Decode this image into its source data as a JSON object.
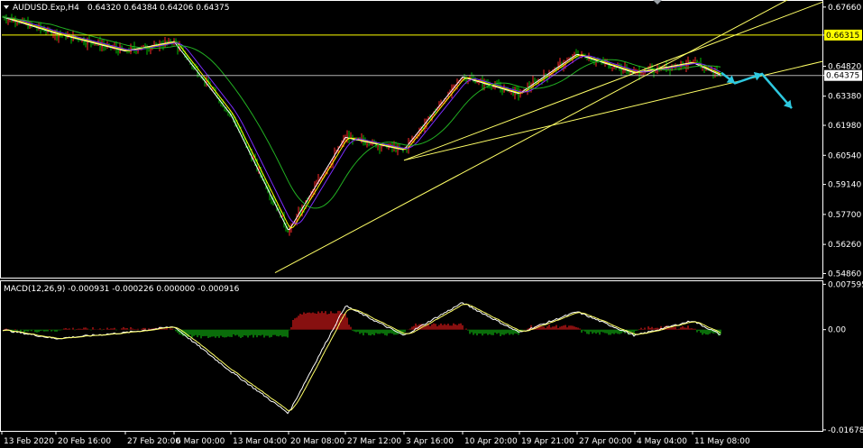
{
  "header": {
    "symbol": "AUDUSD.Exp,H4",
    "ohlc": "0.64320 0.64384 0.64206 0.64375"
  },
  "macd_header": "MACD(12,26,9) -0.000931 -0.000226 0.000000 -0.000916",
  "price_axis": {
    "ticks": [
      "0.67660",
      "0.66315",
      "0.64820",
      "0.64375",
      "0.63380",
      "0.61980",
      "0.60540",
      "0.59140",
      "0.57700",
      "0.56260",
      "0.54860"
    ],
    "hline_high_label": "0.66315",
    "current_price_label": "0.64375",
    "ylim": [
      0.5475,
      0.6787
    ]
  },
  "macd_axis": {
    "ticks": [
      "0.007595",
      "0.00",
      "-0.016785"
    ],
    "ylim": [
      -0.0168,
      0.0078
    ]
  },
  "time_axis": {
    "labels": [
      "13 Feb 2020",
      "20 Feb 16:00",
      "27 Feb 20:00",
      "6 Mar 00:00",
      "13 Mar 04:00",
      "20 Mar 08:00",
      "27 Mar 12:00",
      "3 Apr 16:00",
      "10 Apr 20:00",
      "19 Apr 21:00",
      "27 Apr 00:00",
      "4 May 04:00",
      "11 May 08:00"
    ]
  },
  "colors": {
    "background": "#000000",
    "bull_candle": "#ff2a2a",
    "bear_candle": "#00c000",
    "line_white": "#ffffff",
    "ma_fast": "#ffff00",
    "ma_mid": "#7b2cff",
    "ma_slow": "#22b022",
    "trendline": "#ffff66",
    "forecast_arrow": "#2ec9e0",
    "macd_signal": "#ffff66",
    "hist_pos": "#d01818",
    "hist_neg": "#0fa80f"
  },
  "chart_data": [
    {
      "type": "candlestick",
      "title": "AUDUSD.Exp,H4",
      "ylim": [
        0.5475,
        0.6787
      ],
      "key_points": [
        {
          "x": "13 Feb 2020",
          "y": 0.672
        },
        {
          "x": "20 Feb 16:00",
          "y": 0.664
        },
        {
          "x": "27 Feb 20:00",
          "y": 0.6555
        },
        {
          "x": "6 Mar 00:00",
          "y": 0.66
        },
        {
          "x": "13 Mar 04:00",
          "y": 0.625
        },
        {
          "x": "20 Mar 08:00",
          "y": 0.569
        },
        {
          "x": "27 Mar 12:00",
          "y": 0.614
        },
        {
          "x": "3 Apr 16:00",
          "y": 0.608
        },
        {
          "x": "10 Apr 20:00",
          "y": 0.643
        },
        {
          "x": "19 Apr 21:00",
          "y": 0.635
        },
        {
          "x": "27 Apr 00:00",
          "y": 0.654
        },
        {
          "x": "4 May 04:00",
          "y": 0.645
        },
        {
          "x": "11 May 08:00",
          "y": 0.65
        }
      ],
      "series": [
        {
          "name": "price"
        }
      ],
      "horizontal_lines": [
        0.66315,
        0.64375
      ]
    },
    {
      "type": "line+histogram",
      "title": "MACD(12,26,9)",
      "ylim": [
        -0.0168,
        0.0078
      ],
      "series": [
        {
          "name": "MACD histogram"
        },
        {
          "name": "MACD main"
        },
        {
          "name": "Signal"
        }
      ],
      "key_points": [
        {
          "x": "13 Feb 2020",
          "y": 0.0
        },
        {
          "x": "20 Feb 16:00",
          "y": -0.0015
        },
        {
          "x": "27 Feb 20:00",
          "y": -0.0005
        },
        {
          "x": "6 Mar 00:00",
          "y": 0.0005
        },
        {
          "x": "13 Mar 04:00",
          "y": -0.007
        },
        {
          "x": "20 Mar 08:00",
          "y": -0.014
        },
        {
          "x": "27 Mar 12:00",
          "y": 0.004
        },
        {
          "x": "3 Apr 16:00",
          "y": -0.001
        },
        {
          "x": "10 Apr 20:00",
          "y": 0.0045
        },
        {
          "x": "19 Apr 21:00",
          "y": -0.0005
        },
        {
          "x": "27 Apr 00:00",
          "y": 0.003
        },
        {
          "x": "4 May 04:00",
          "y": -0.001
        },
        {
          "x": "11 May 08:00",
          "y": 0.0015
        }
      ]
    }
  ]
}
